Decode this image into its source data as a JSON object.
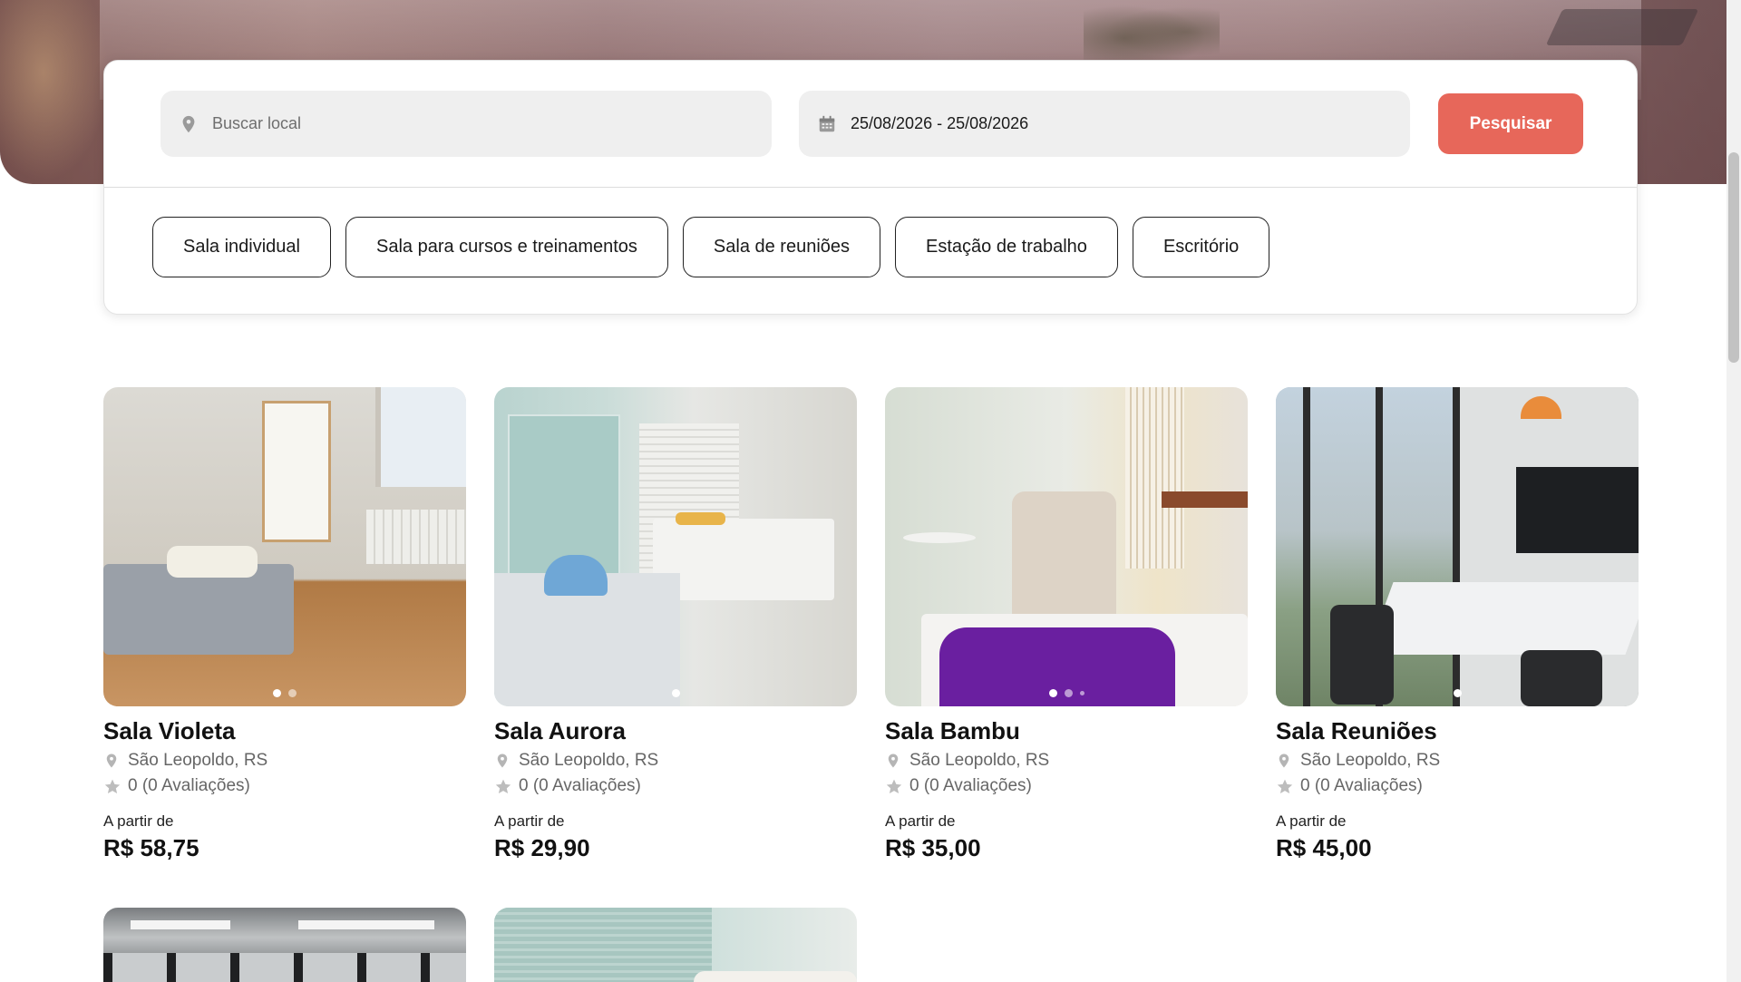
{
  "search": {
    "location_placeholder": "Buscar local",
    "date_range": "25/08/2026 - 25/08/2026",
    "submit_label": "Pesquisar"
  },
  "categories": [
    "Sala individual",
    "Sala para cursos e treinamentos",
    "Sala de reuniões",
    "Estação de trabalho",
    "Escritório"
  ],
  "listings": [
    {
      "name": "Sala Violeta",
      "location": "São Leopoldo, RS",
      "rating": "0 (0 Avaliações)",
      "price_prefix": "A partir de",
      "price": "R$ 58,75"
    },
    {
      "name": "Sala Aurora",
      "location": "São Leopoldo, RS",
      "rating": "0 (0 Avaliações)",
      "price_prefix": "A partir de",
      "price": "R$ 29,90"
    },
    {
      "name": "Sala Bambu",
      "location": "São Leopoldo, RS",
      "rating": "0 (0 Avaliações)",
      "price_prefix": "A partir de",
      "price": "R$ 35,00"
    },
    {
      "name": "Sala Reuniões",
      "location": "São Leopoldo, RS",
      "rating": "0 (0 Avaliações)",
      "price_prefix": "A partir de",
      "price": "R$ 45,00"
    }
  ],
  "icons": {
    "location": "map-pin-icon",
    "calendar": "calendar-icon",
    "rating": "star-icon"
  },
  "colors": {
    "accent": "#e7675a",
    "field_bg": "#efefef",
    "muted_text": "#666666"
  }
}
